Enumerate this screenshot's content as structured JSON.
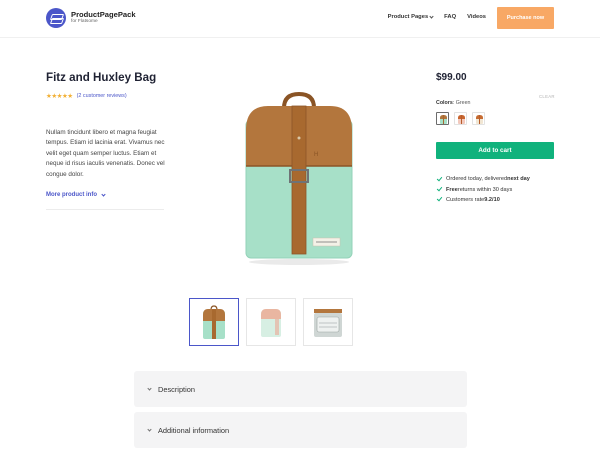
{
  "header": {
    "logo_name": "ProductPagePack",
    "logo_sub": "for Flatsome",
    "nav": [
      {
        "label": "Product Pages",
        "has_dropdown": true
      },
      {
        "label": "FAQ",
        "has_dropdown": false
      },
      {
        "label": "Videos",
        "has_dropdown": false
      }
    ],
    "purchase_label": "Purchase now"
  },
  "product": {
    "title": "Fitz and Huxley Bag",
    "rating_value": 4.5,
    "rating_max": 5,
    "reviews_label": "(2 customer reviews)",
    "description": "Nullam tincidunt libero et magna feugiat tempus. Etiam id lacinia erat. Vivamus nec velit eget quam semper luctus. Etiam et neque id risus iaculis venenatis. Donec vel congue dolor.",
    "more_info_label": "More product info",
    "price": "$99.00",
    "clear_label": "CLEAR",
    "colors_label": "Colors",
    "colors_value": "Green",
    "swatch_count": 3,
    "add_to_cart_label": "Add to cart",
    "benefits": {
      "b1_text": "Ordered today, delivered ",
      "b1_bold": "next day",
      "b2_bold": "Free",
      "b2_text": " returns within 30 days",
      "b3_text": "Customers rate ",
      "b3_bold": "9.2/10"
    }
  },
  "accordions": {
    "description_label": "Description",
    "additional_label": "Additional information"
  },
  "colors": {
    "brand": "#4b56c9",
    "purchase": "#f8a865",
    "cart": "#10b27c",
    "star": "#f2b035",
    "mint": "#9fdcc4",
    "leather": "#b0723a"
  }
}
